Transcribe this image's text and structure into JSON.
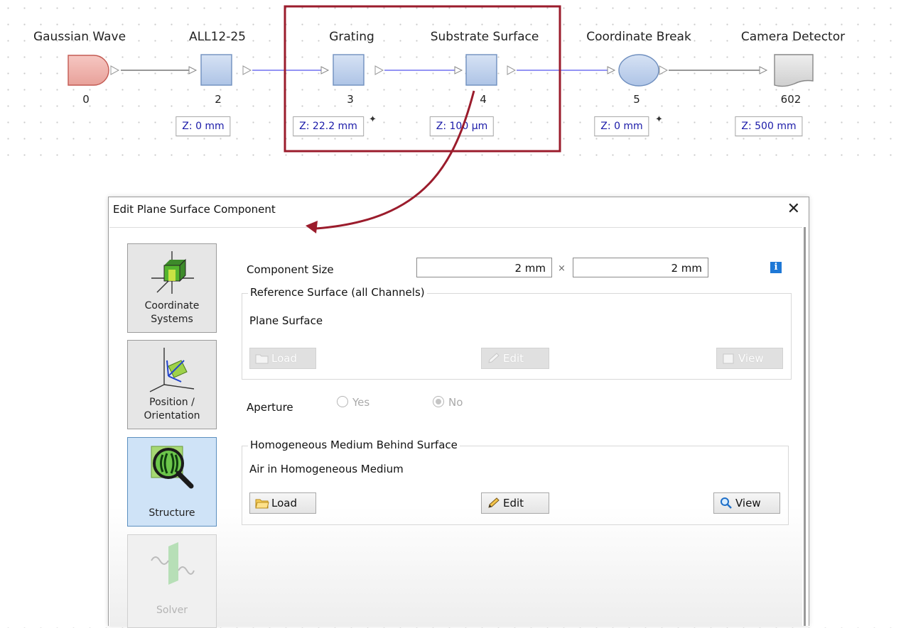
{
  "pipeline": {
    "nodes": [
      {
        "label": "Gaussian Wave",
        "index": "0",
        "z": ""
      },
      {
        "label": "ALL12-25",
        "index": "2",
        "z": "Z: 0 mm"
      },
      {
        "label": "Grating",
        "index": "3",
        "z": "Z: 22.2 mm"
      },
      {
        "label": "Substrate Surface",
        "index": "4",
        "z": "Z: 100 µm"
      },
      {
        "label": "Coordinate Break",
        "index": "5",
        "z": "Z: 0 mm"
      },
      {
        "label": "Camera Detector",
        "index": "602",
        "z": "Z: 500 mm"
      }
    ],
    "colors": {
      "highlight": "#9b1c2c",
      "link_active": "#7070f0",
      "link": "#777777"
    }
  },
  "dialog": {
    "title": "Edit Plane Surface Component",
    "close_glyph": "✕",
    "sidebar": [
      {
        "label": "Coordinate Systems",
        "icon": "coordinate-systems-icon",
        "state": "normal"
      },
      {
        "label": "Position / Orientation",
        "icon": "position-orientation-icon",
        "state": "normal"
      },
      {
        "label": "Structure",
        "icon": "structure-icon",
        "state": "active"
      },
      {
        "label": "Solver",
        "icon": "solver-icon",
        "state": "disabled"
      }
    ],
    "component_size": {
      "label": "Component Size",
      "width": "2 mm",
      "times": "×",
      "height": "2 mm",
      "info": "i"
    },
    "reference_surface": {
      "title": "Reference Surface (all Channels)",
      "value": "Plane Surface",
      "load": "Load",
      "edit": "Edit",
      "view": "View"
    },
    "aperture": {
      "label": "Aperture",
      "yes": "Yes",
      "no": "No",
      "selected": "No"
    },
    "medium": {
      "title": "Homogeneous Medium Behind Surface",
      "value": "Air in Homogeneous Medium",
      "load": "Load",
      "edit": "Edit",
      "view": "View"
    }
  }
}
